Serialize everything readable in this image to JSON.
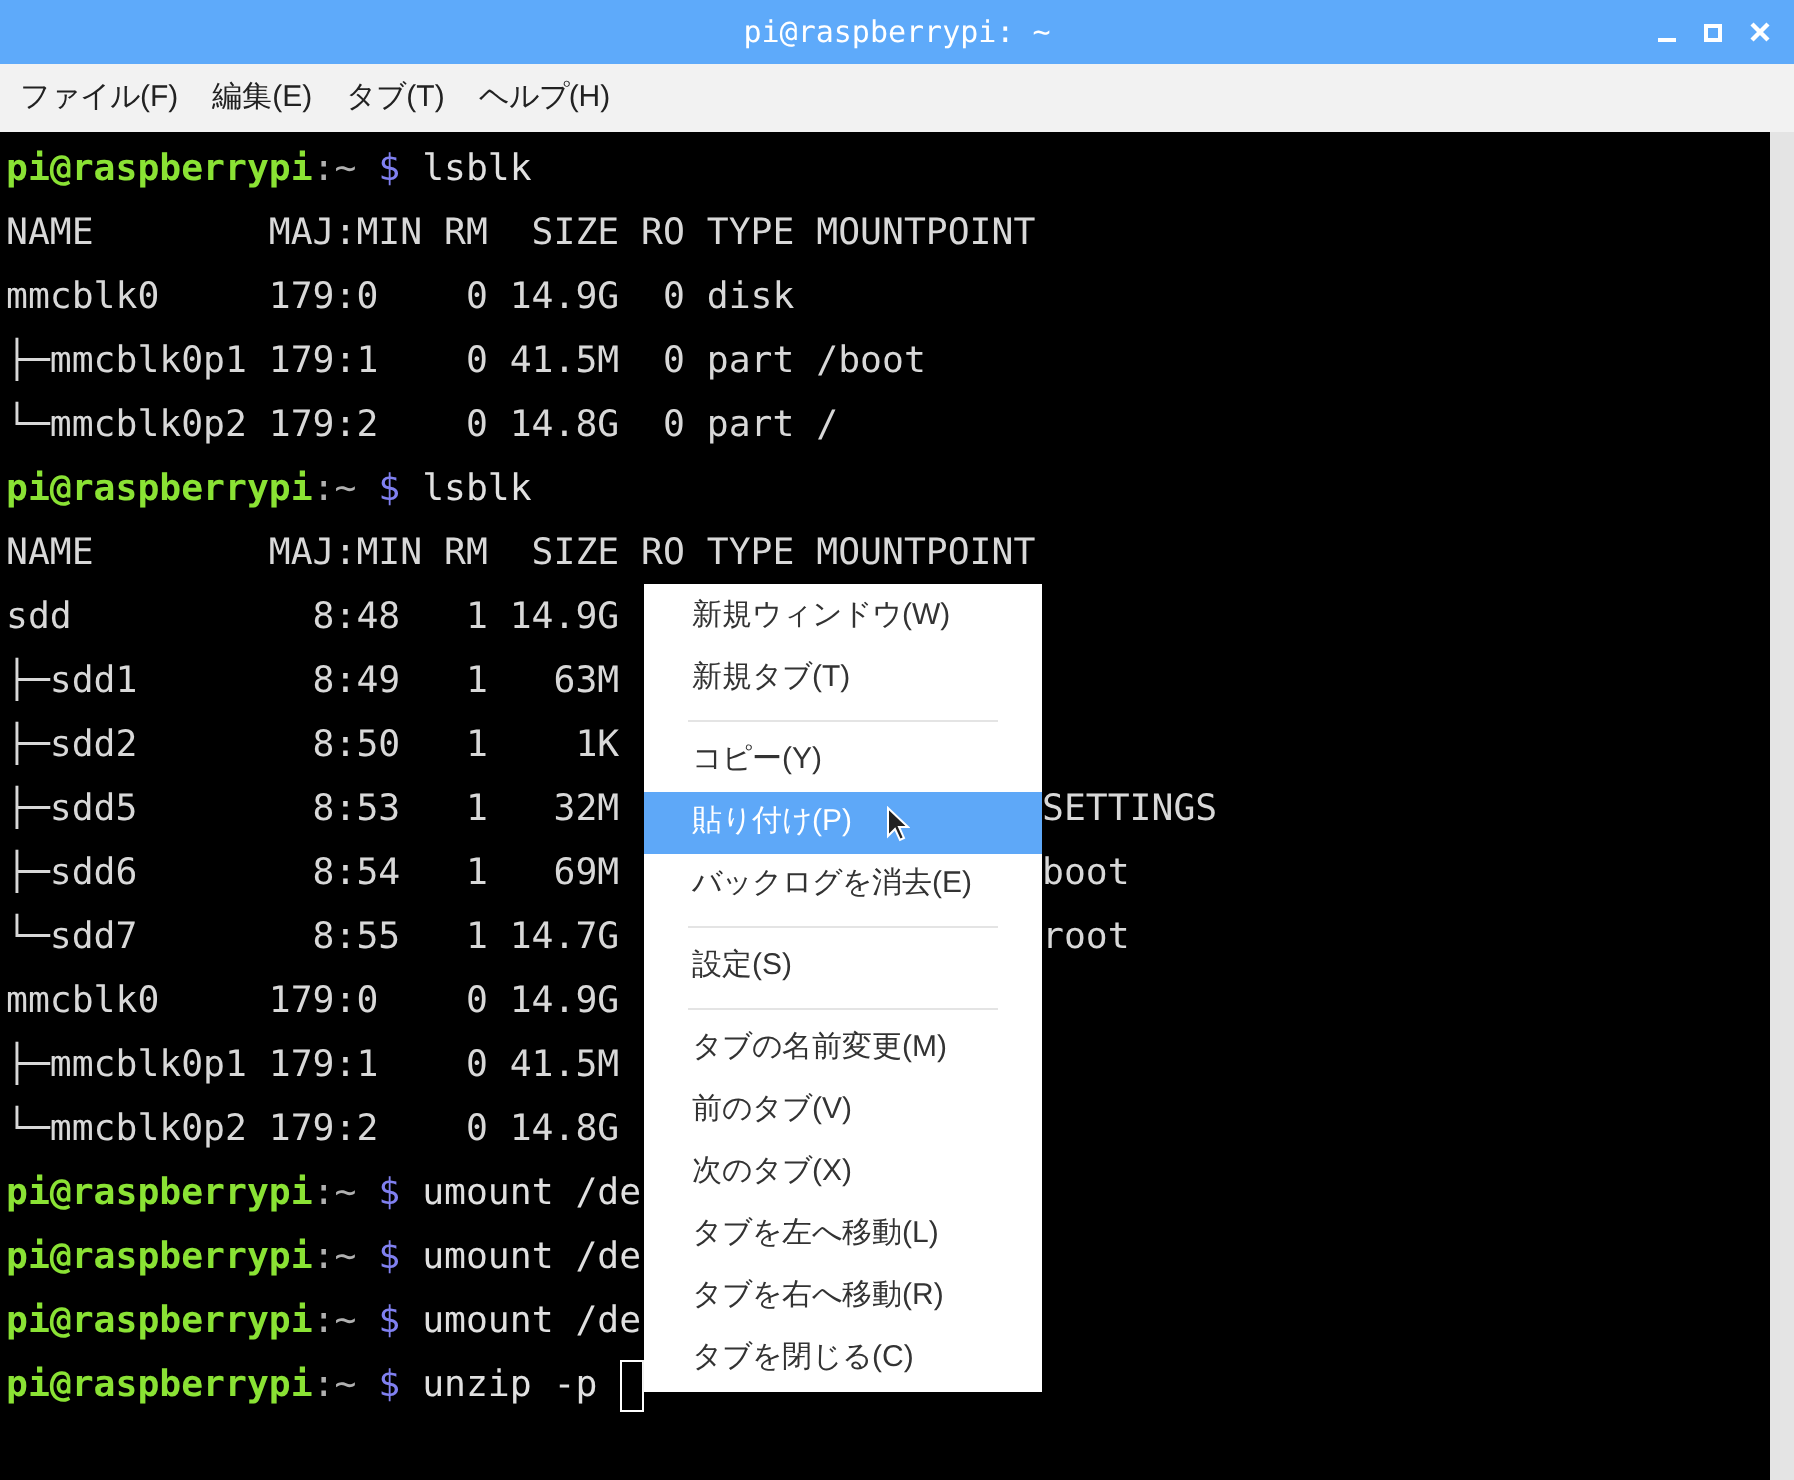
{
  "window": {
    "title": "pi@raspberrypi: ~"
  },
  "menubar": [
    "ファイル(F)",
    "編集(E)",
    "タブ(T)",
    "ヘルプ(H)"
  ],
  "terminal": {
    "lines": [
      {
        "kind": "prompt",
        "user": "pi@raspberrypi",
        "path": ":~",
        "symbol": "$",
        "command": "lsblk"
      },
      {
        "kind": "output",
        "text": "NAME        MAJ:MIN RM  SIZE RO TYPE MOUNTPOINT"
      },
      {
        "kind": "output",
        "text": "mmcblk0     179:0    0 14.9G  0 disk"
      },
      {
        "kind": "output",
        "text": "├─mmcblk0p1 179:1    0 41.5M  0 part /boot"
      },
      {
        "kind": "output",
        "text": "└─mmcblk0p2 179:2    0 14.8G  0 part /"
      },
      {
        "kind": "prompt",
        "user": "pi@raspberrypi",
        "path": ":~",
        "symbol": "$",
        "command": "lsblk"
      },
      {
        "kind": "output",
        "text": "NAME        MAJ:MIN RM  SIZE RO TYPE MOUNTPOINT"
      },
      {
        "kind": "output",
        "text": "sdd           8:48   1 14.9G"
      },
      {
        "kind": "output",
        "text": "├─sdd1        8:49   1   63M"
      },
      {
        "kind": "output",
        "text": "├─sdd2        8:50   1    1K"
      },
      {
        "kind": "output",
        "text": "├─sdd5        8:53   1   32M",
        "tail": "SETTINGS"
      },
      {
        "kind": "output",
        "text": "├─sdd6        8:54   1   69M",
        "tail": "boot"
      },
      {
        "kind": "output",
        "text": "└─sdd7        8:55   1 14.7G",
        "tail": "root"
      },
      {
        "kind": "output",
        "text": "mmcblk0     179:0    0 14.9G"
      },
      {
        "kind": "output",
        "text": "├─mmcblk0p1 179:1    0 41.5M"
      },
      {
        "kind": "output",
        "text": "└─mmcblk0p2 179:2    0 14.8G"
      },
      {
        "kind": "prompt",
        "user": "pi@raspberrypi",
        "path": ":~",
        "symbol": "$",
        "command": "umount /de"
      },
      {
        "kind": "prompt",
        "user": "pi@raspberrypi",
        "path": ":~",
        "symbol": "$",
        "command": "umount /de"
      },
      {
        "kind": "prompt",
        "user": "pi@raspberrypi",
        "path": ":~",
        "symbol": "$",
        "command": "umount /de"
      },
      {
        "kind": "prompt",
        "user": "pi@raspberrypi",
        "path": ":~",
        "symbol": "$",
        "command": "unzip -p ",
        "cursor": true
      }
    ]
  },
  "context_menu": {
    "items": [
      {
        "kind": "item",
        "label": "新規ウィンドウ(W)",
        "selected": false
      },
      {
        "kind": "item",
        "label": "新規タブ(T)",
        "selected": false
      },
      {
        "kind": "separator"
      },
      {
        "kind": "item",
        "label": "コピー(Y)",
        "selected": false
      },
      {
        "kind": "item",
        "label": "貼り付け(P)",
        "selected": true
      },
      {
        "kind": "item",
        "label": "バックログを消去(E)",
        "selected": false
      },
      {
        "kind": "separator"
      },
      {
        "kind": "item",
        "label": "設定(S)",
        "selected": false
      },
      {
        "kind": "separator"
      },
      {
        "kind": "item",
        "label": "タブの名前変更(M)",
        "selected": false
      },
      {
        "kind": "item",
        "label": "前のタブ(V)",
        "selected": false
      },
      {
        "kind": "item",
        "label": "次のタブ(X)",
        "selected": false
      },
      {
        "kind": "item",
        "label": "タブを左へ移動(L)",
        "selected": false
      },
      {
        "kind": "item",
        "label": "タブを右へ移動(R)",
        "selected": false
      },
      {
        "kind": "item",
        "label": "タブを閉じる(C)",
        "selected": false
      }
    ]
  }
}
